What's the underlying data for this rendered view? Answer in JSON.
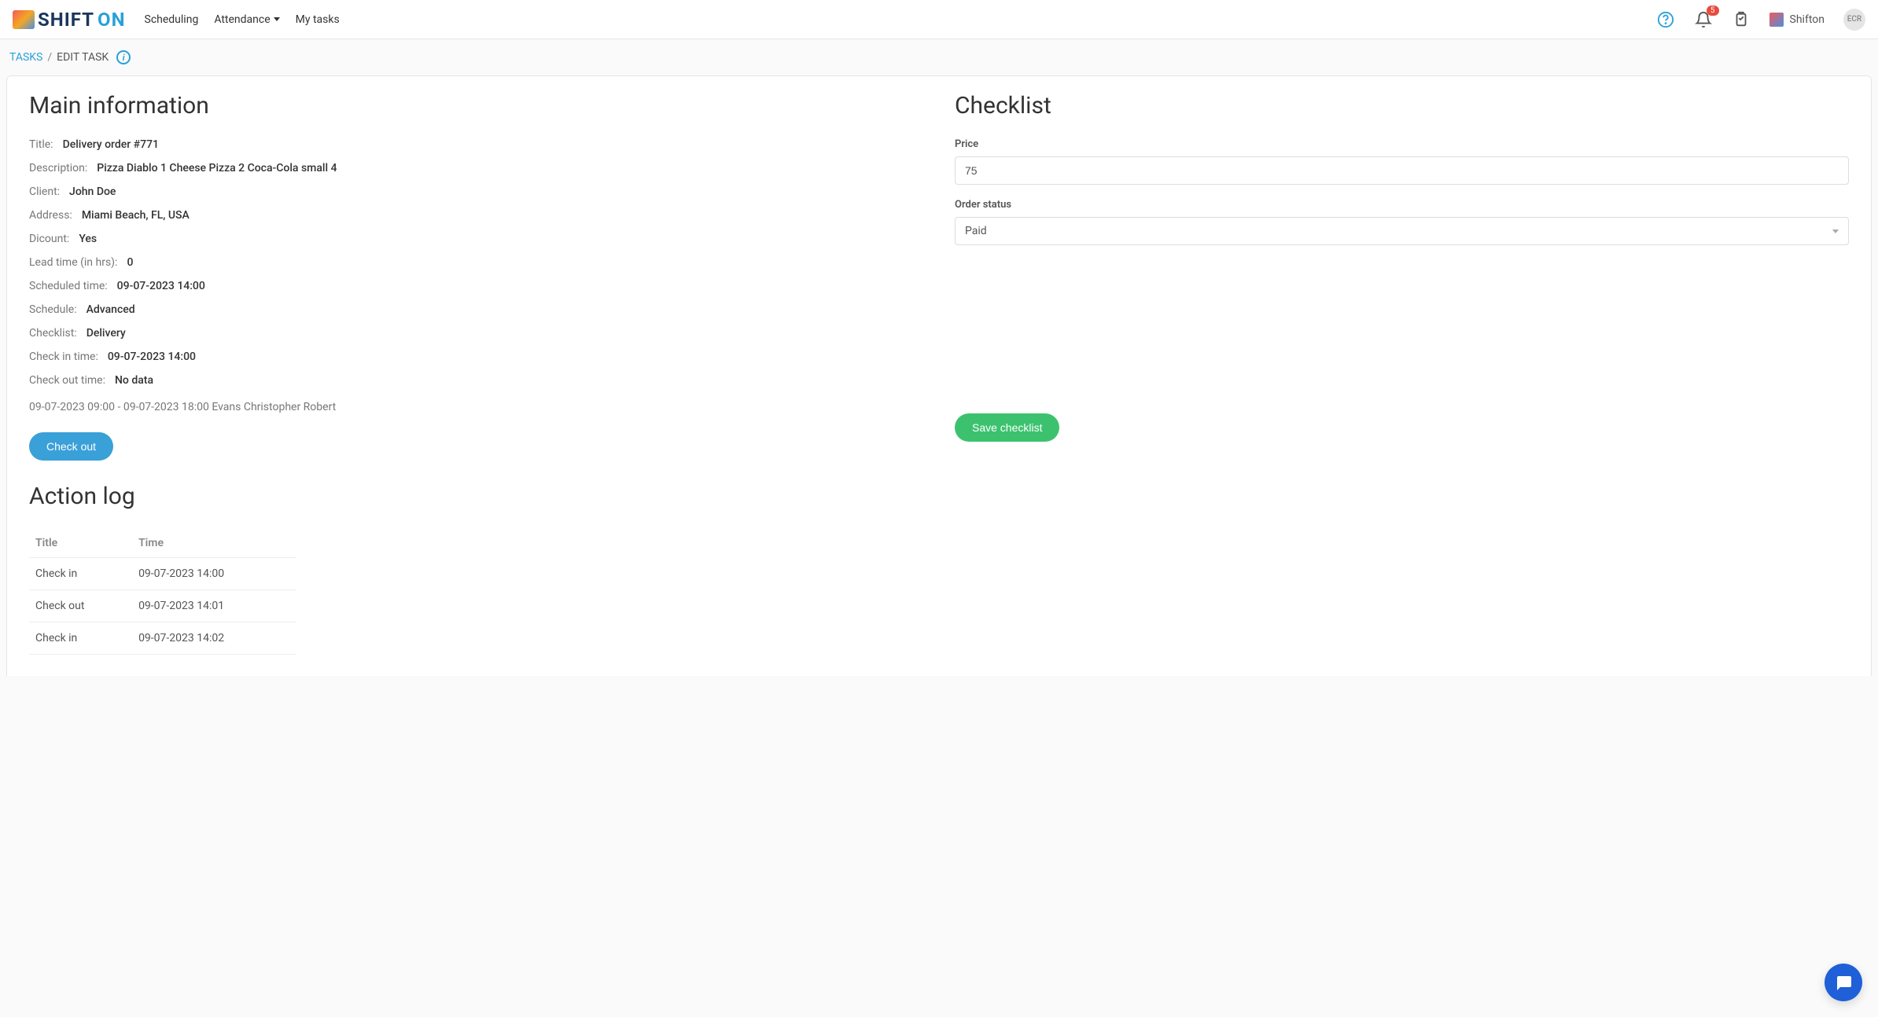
{
  "header": {
    "logo_text_1": "SHIFT",
    "logo_text_2": "ON",
    "nav": {
      "scheduling": "Scheduling",
      "attendance": "Attendance",
      "my_tasks": "My tasks"
    },
    "notification_count": "5",
    "company_name": "Shifton",
    "avatar_initials": "ECR"
  },
  "breadcrumb": {
    "tasks": "TASKS",
    "sep": "/",
    "current": "EDIT TASK"
  },
  "main": {
    "heading": "Main information",
    "rows": {
      "title_label": "Title:",
      "title_value": "Delivery order #771",
      "desc_label": "Description:",
      "desc_value": "Pizza Diablo 1 Cheese Pizza 2 Coca-Cola small 4",
      "client_label": "Client:",
      "client_value": "John Doe",
      "address_label": "Address:",
      "address_value": "Miami Beach, FL, USA",
      "discount_label": "Dicount:",
      "discount_value": "Yes",
      "lead_label": "Lead time (in hrs):",
      "lead_value": "0",
      "sched_time_label": "Scheduled time:",
      "sched_time_value": "09-07-2023 14:00",
      "schedule_label": "Schedule:",
      "schedule_value": "Advanced",
      "checklist_label": "Checklist:",
      "checklist_value": "Delivery",
      "checkin_label": "Check in time:",
      "checkin_value": "09-07-2023 14:00",
      "checkout_label": "Check out time:",
      "checkout_value": "No data"
    },
    "shift_line": "09-07-2023 09:00 - 09-07-2023 18:00 Evans Christopher Robert",
    "checkout_btn": "Check out"
  },
  "checklist": {
    "heading": "Checklist",
    "price_label": "Price",
    "price_value": "75",
    "status_label": "Order status",
    "status_value": "Paid",
    "save_btn": "Save checklist"
  },
  "action_log": {
    "heading": "Action log",
    "col_title": "Title",
    "col_time": "Time",
    "rows": [
      {
        "title": "Check in",
        "time": "09-07-2023 14:00"
      },
      {
        "title": "Check out",
        "time": "09-07-2023 14:01"
      },
      {
        "title": "Check in",
        "time": "09-07-2023 14:02"
      }
    ]
  }
}
